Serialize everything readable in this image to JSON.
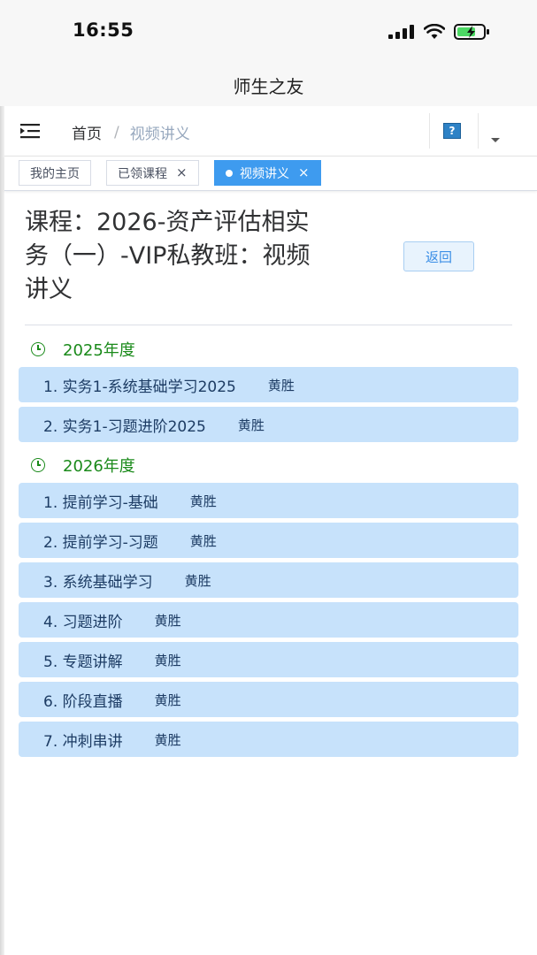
{
  "status": {
    "time": "16:55"
  },
  "app": {
    "title": "师生之友"
  },
  "breadcrumb": {
    "home": "首页",
    "separator": "/",
    "current": "视频讲义"
  },
  "help": {
    "label": "?"
  },
  "tags": [
    {
      "label": "我的主页",
      "closable": false,
      "active": false
    },
    {
      "label": "已领课程",
      "closable": true,
      "active": false
    },
    {
      "label": "视频讲义",
      "closable": true,
      "active": true
    }
  ],
  "tag_close_glyph": "×",
  "course": {
    "title_line1": "课程：2026-资产评估相实",
    "title_line2": "务（一）-VIP私教班：视频",
    "title_line3": "讲义",
    "return_label": "返回"
  },
  "sections": [
    {
      "year_label": "2025年度",
      "items": [
        {
          "label": "1. 实务1-系统基础学习2025",
          "teacher": "黄胜"
        },
        {
          "label": "2. 实务1-习题进阶2025",
          "teacher": "黄胜"
        }
      ]
    },
    {
      "year_label": "2026年度",
      "items": [
        {
          "label": "1. 提前学习-基础",
          "teacher": "黄胜"
        },
        {
          "label": "2. 提前学习-习题",
          "teacher": "黄胜"
        },
        {
          "label": "3. 系统基础学习",
          "teacher": "黄胜"
        },
        {
          "label": "4. 习题进阶",
          "teacher": "黄胜"
        },
        {
          "label": "5. 专题讲解",
          "teacher": "黄胜"
        },
        {
          "label": "6. 阶段直播",
          "teacher": "黄胜"
        },
        {
          "label": "7. 冲刺串讲",
          "teacher": "黄胜"
        }
      ]
    }
  ],
  "colors": {
    "accent": "#3e9bef",
    "item_bg": "#c7e2fb",
    "year_green": "#1a8a1a"
  }
}
